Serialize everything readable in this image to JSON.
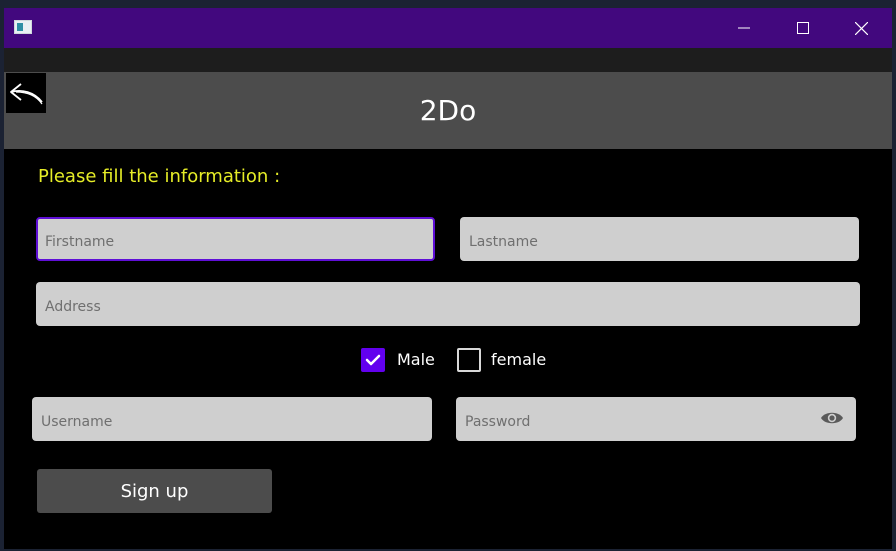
{
  "window": {
    "controls": {
      "minimize_icon": "minimize-icon",
      "maximize_icon": "maximize-icon",
      "close_icon": "close-icon"
    }
  },
  "header": {
    "title": "2Do",
    "back_icon": "back-arrow-icon"
  },
  "form": {
    "instruction": "Please fill the information :",
    "firstname": {
      "placeholder": "Firstname",
      "value": ""
    },
    "lastname": {
      "placeholder": "Lastname",
      "value": ""
    },
    "address": {
      "placeholder": "Address",
      "value": ""
    },
    "gender": {
      "male": {
        "label": "Male",
        "checked": true
      },
      "female": {
        "label": "female",
        "checked": false
      }
    },
    "username": {
      "placeholder": "Username",
      "value": ""
    },
    "password": {
      "placeholder": "Password",
      "value": "",
      "reveal_icon": "eye-icon"
    },
    "signup_label": "Sign up"
  },
  "colors": {
    "titlebar": "#42087e",
    "accent": "#6200ee",
    "instruction": "#e6ed27",
    "header": "#4c4c4c",
    "field": "#cfcfcf"
  }
}
